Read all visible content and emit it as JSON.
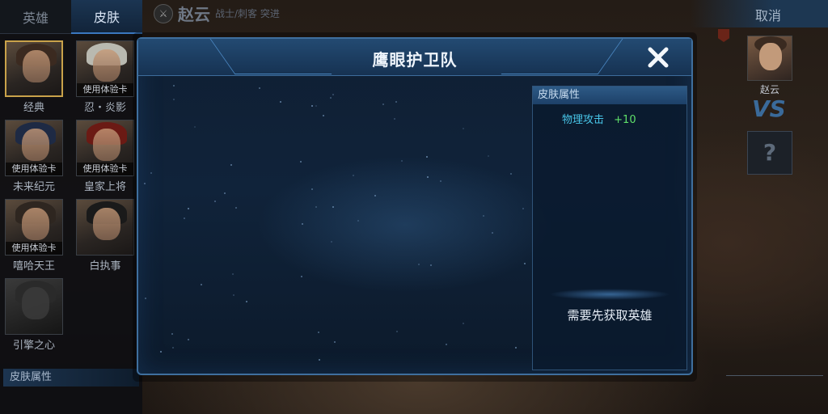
{
  "left_panel": {
    "tabs": [
      {
        "label": "英雄",
        "active": false
      },
      {
        "label": "皮肤",
        "active": true
      }
    ],
    "skins": [
      {
        "name": "经典",
        "trial": "",
        "selected": true
      },
      {
        "name": "忍・炎影",
        "trial": "使用体验卡",
        "selected": false
      },
      {
        "name": "未来纪元",
        "trial": "使用体验卡",
        "selected": false
      },
      {
        "name": "皇家上将",
        "trial": "使用体验卡",
        "selected": false
      },
      {
        "name": "嘻哈天王",
        "trial": "使用体验卡",
        "selected": false
      },
      {
        "name": "白执事",
        "trial": "",
        "selected": false
      },
      {
        "name": "引擎之心",
        "trial": "",
        "selected": false
      }
    ],
    "footer_label": "皮肤属性"
  },
  "hero": {
    "name": "赵云",
    "roles": "战士/刺客 突进"
  },
  "right_panel": {
    "cancel_label": "取消",
    "portrait_name": "赵云",
    "vs_label": "VS",
    "unknown_label": "?"
  },
  "modal": {
    "title": "鹰眼护卫队",
    "close_icon": "close-icon",
    "attributes": {
      "header": "皮肤属性",
      "items": [
        {
          "name": "物理攻击",
          "value": "+10"
        }
      ],
      "note": "需要先获取英雄"
    }
  },
  "colors": {
    "accent_blue": "#3f6f9e",
    "attr_name": "#48c6e8",
    "attr_value": "#5fe06a",
    "selected_border": "#c9a24a"
  }
}
